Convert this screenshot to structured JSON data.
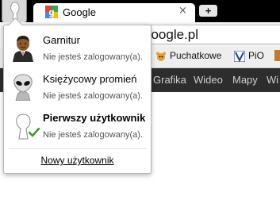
{
  "tab": {
    "title": "Google",
    "close_glyph": "×"
  },
  "new_tab_glyph": "+",
  "omnibox": {
    "visible_url": "google.pl"
  },
  "bookmarks": [
    {
      "label": "Puchatkowe",
      "icon": "bear-icon"
    },
    {
      "label": "PiO",
      "icon": "pio-icon"
    }
  ],
  "google_nav": [
    "Grafika",
    "Wideo",
    "Mapy",
    "Wi"
  ],
  "profile_menu": {
    "profiles": [
      {
        "name": "Garnitur",
        "status": "Nie jesteś zalogowany(a).",
        "avatar": "suit-man-avatar",
        "active": false
      },
      {
        "name": "Księżycowy promień",
        "status": "Nie jesteś zalogowany(a).",
        "avatar": "alien-avatar",
        "active": false
      },
      {
        "name": "Pierwszy użytkownik",
        "status": "Nie jesteś zalogowany(a).",
        "avatar": "generic-user-avatar",
        "active": true
      }
    ],
    "new_user_label": "Nowy użytkownik"
  },
  "colors": {
    "tabstrip_bg": "#000000",
    "google_bar_bg": "#2d2d2d",
    "check_green": "#3c9a2a"
  }
}
